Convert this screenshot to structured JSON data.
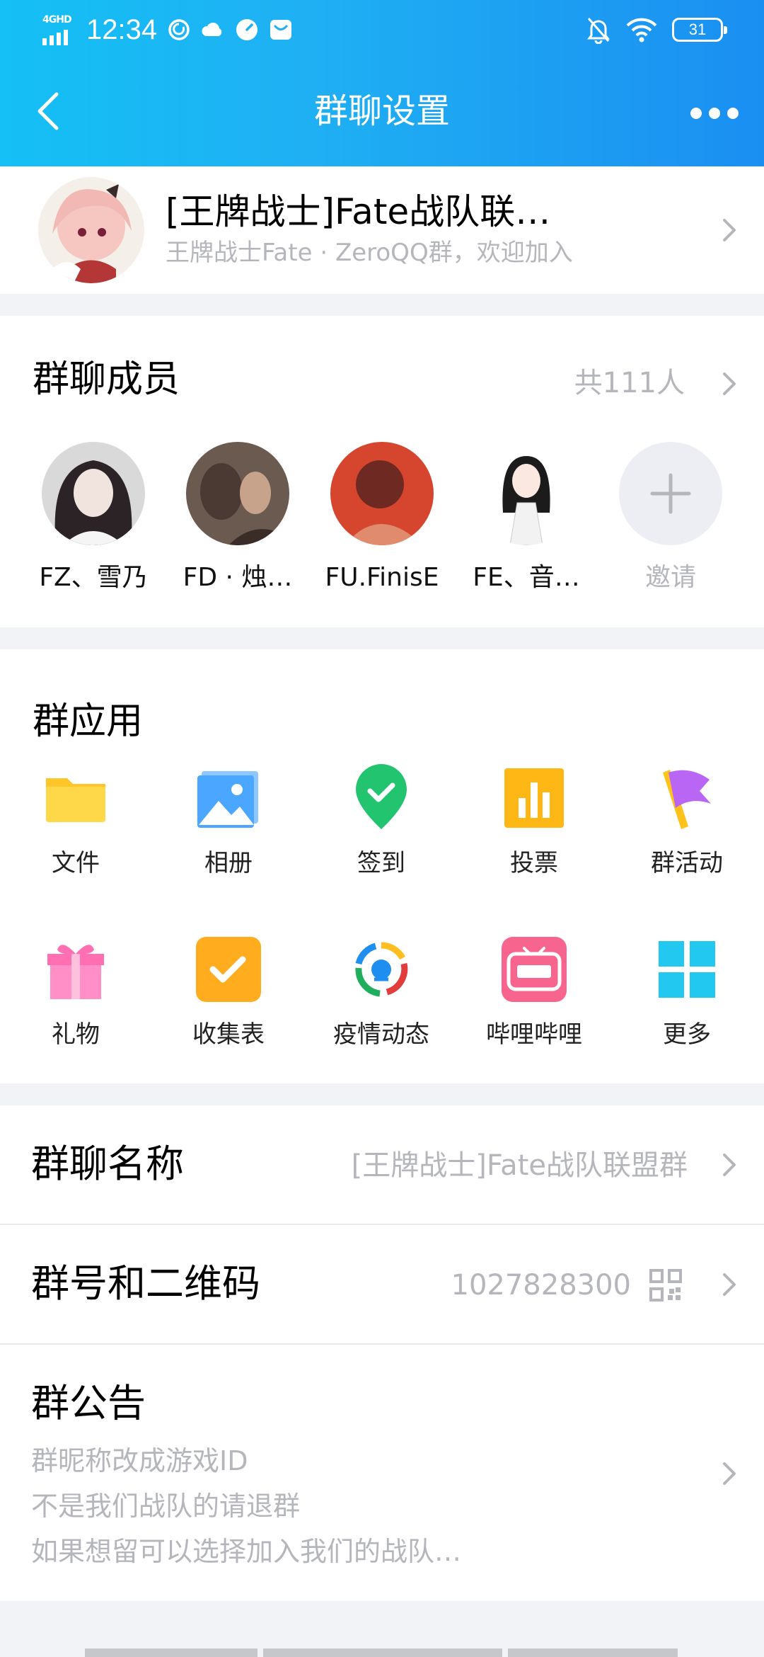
{
  "status_bar": {
    "network": "4GHD",
    "time": "12:34",
    "battery": "31"
  },
  "header": {
    "title": "群聊设置",
    "back_icon": "chevron-left-icon",
    "more_icon": "more-dots-icon"
  },
  "group": {
    "name": "[王牌战士]Fate战队联…",
    "description": "王牌战士Fate · ZeroQQ群，欢迎加入"
  },
  "members": {
    "title": "群聊成员",
    "count": "共111人",
    "items": [
      {
        "name": "FZ、雪乃"
      },
      {
        "name": "FD · 烛…"
      },
      {
        "name": "FU.FinisE"
      },
      {
        "name": "FE、音…"
      }
    ],
    "invite_label": "邀请"
  },
  "apps": {
    "title": "群应用",
    "items": [
      {
        "label": "文件",
        "icon": "folder-icon"
      },
      {
        "label": "相册",
        "icon": "album-icon"
      },
      {
        "label": "签到",
        "icon": "checkin-icon"
      },
      {
        "label": "投票",
        "icon": "vote-icon"
      },
      {
        "label": "群活动",
        "icon": "flag-icon"
      },
      {
        "label": "礼物",
        "icon": "gift-icon"
      },
      {
        "label": "收集表",
        "icon": "form-icon"
      },
      {
        "label": "疫情动态",
        "icon": "epidemic-icon"
      },
      {
        "label": "哔哩哔哩",
        "icon": "bilibili-icon"
      },
      {
        "label": "更多",
        "icon": "grid-more-icon"
      }
    ]
  },
  "settings": {
    "group_name_label": "群聊名称",
    "group_name_value": "[王牌战士]Fate战队联盟群",
    "group_id_label": "群号和二维码",
    "group_id_value": "1027828300",
    "announcement_label": "群公告",
    "announcement_lines": [
      "群昵称改成游戏ID",
      "不是我们战队的请退群",
      "如果想留可以选择加入我们的战队…"
    ]
  },
  "colors": {
    "header_start": "#14c0f5",
    "header_end": "#1a8ff2",
    "muted_text": "#b4b6bc"
  }
}
